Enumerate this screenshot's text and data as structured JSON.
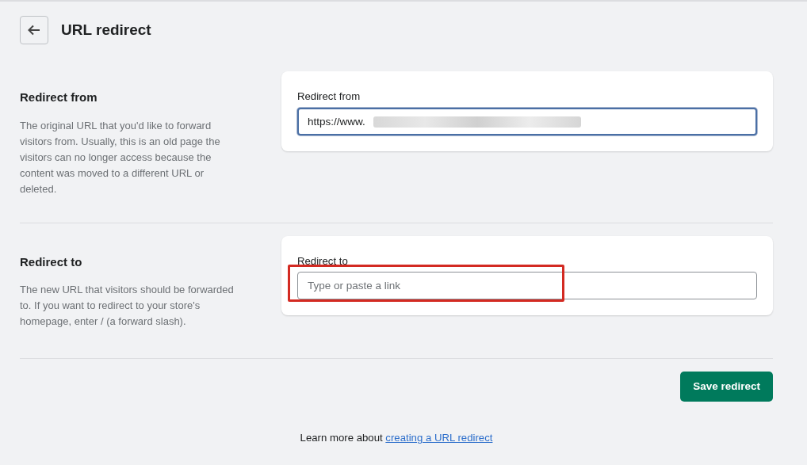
{
  "page": {
    "title": "URL redirect"
  },
  "sections": [
    {
      "heading": "Redirect from",
      "description": "The original URL that you'd like to forward visitors from. Usually, this is an old page the visitors can no longer access because the content was moved to a different URL or deleted.",
      "field": {
        "label": "Redirect from",
        "value": "https://www.",
        "value_blurred": true,
        "focused": true,
        "highlighted": false
      }
    },
    {
      "heading": "Redirect to",
      "description": "The new URL that visitors should be forwarded to. If you want to redirect to your store's homepage, enter / (a forward slash).",
      "field": {
        "label": "Redirect to",
        "placeholder": "Type or paste a link",
        "value_blurred": false,
        "focused": false,
        "highlighted": true
      }
    }
  ],
  "save_button": {
    "label": "Save redirect"
  },
  "footer": {
    "text": "Learn more about ",
    "link": "creating a URL redirect"
  }
}
